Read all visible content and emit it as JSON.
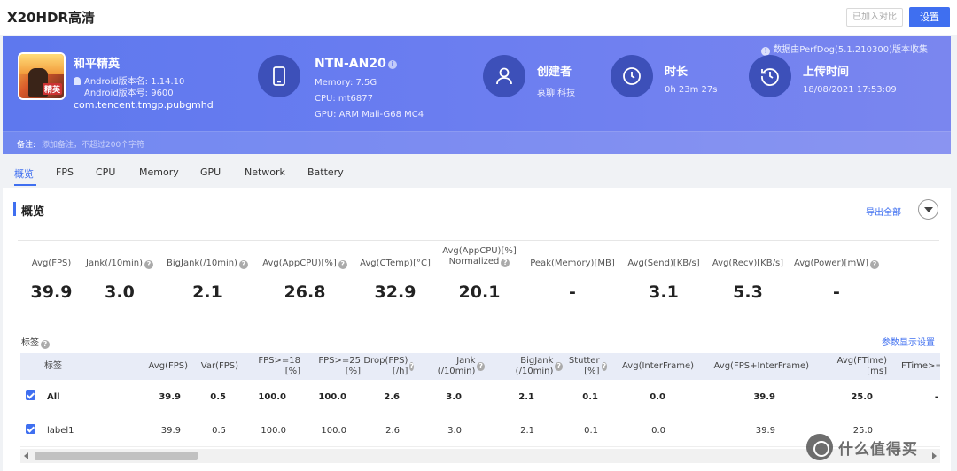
{
  "topbar": {
    "title": "X20HDR高清",
    "added_button": "已加入对比",
    "settings_button": "设置"
  },
  "banner": {
    "notice": "数据由PerfDog(5.1.210300)版本收集",
    "app": {
      "name": "和平精英",
      "icon_text": "和平精英",
      "android_version": "Android版本名: 1.14.10",
      "android_build": "Android版本号: 9600",
      "package": "com.tencent.tmgp.pubgmhd"
    },
    "device": {
      "name": "NTN-AN20",
      "memory": "Memory: 7.5G",
      "cpu": "CPU: mt6877",
      "gpu": "GPU: ARM Mali-G68 MC4"
    },
    "creator": {
      "title": "创建者",
      "value": "哀聊 科技"
    },
    "duration": {
      "title": "时长",
      "value": "0h 23m 27s"
    },
    "upload": {
      "title": "上传时间",
      "value": "18/08/2021 17:53:09"
    },
    "note_label": "备注:",
    "note_placeholder": "添加备注，不超过200个字符"
  },
  "tabs": [
    "概览",
    "FPS",
    "CPU",
    "Memory",
    "GPU",
    "Network",
    "Battery"
  ],
  "overview": {
    "title": "概览",
    "export": "导出全部",
    "metrics": [
      {
        "label": "Avg(FPS)",
        "value": "39.9",
        "help": false
      },
      {
        "label": "Jank(/10min)",
        "value": "3.0",
        "help": true
      },
      {
        "label": "BigJank(/10min)",
        "value": "2.1",
        "help": true
      },
      {
        "label": "Avg(AppCPU)[%]",
        "value": "26.8",
        "help": true
      },
      {
        "label": "Avg(CTemp)[°C]",
        "value": "32.9",
        "help": false
      },
      {
        "label": "Avg(AppCPU)[%] Normalized",
        "value": "20.1",
        "help": true
      },
      {
        "label": "Peak(Memory)[MB]",
        "value": "-",
        "help": false
      },
      {
        "label": "Avg(Send)[KB/s]",
        "value": "3.1",
        "help": false
      },
      {
        "label": "Avg(Recv)[KB/s]",
        "value": "5.3",
        "help": false
      },
      {
        "label": "Avg(Power)[mW]",
        "value": "-",
        "help": true
      }
    ],
    "tags_title": "标签",
    "param_settings": "参数显示设置",
    "table": {
      "headers": [
        "标签",
        "Avg(FPS)",
        "Var(FPS)",
        "FPS>=18 [%]",
        "FPS>=25 [%]",
        "Drop(FPS) [/h]",
        "Jank (/10min)",
        "BigJank (/10min)",
        "Stutter [%]",
        "Avg(InterFrame)",
        "Avg(FPS+InterFrame)",
        "Avg(FTime) [ms]",
        "FTime>="
      ],
      "rows": [
        {
          "label": "All",
          "checked": true,
          "cells": [
            "39.9",
            "0.5",
            "100.0",
            "100.0",
            "2.6",
            "3.0",
            "2.1",
            "0.1",
            "0.0",
            "39.9",
            "25.0",
            "-"
          ]
        },
        {
          "label": "label1",
          "checked": true,
          "cells": [
            "39.9",
            "0.5",
            "100.0",
            "100.0",
            "2.6",
            "3.0",
            "2.1",
            "0.1",
            "0.0",
            "39.9",
            "25.0",
            ""
          ]
        }
      ]
    }
  },
  "watermark": "什么值得买",
  "colors": {
    "accent": "#3f6ff0",
    "banner_start": "#5e78ee",
    "banner_end": "#7a86ef",
    "icon_circle": "#3d50b9"
  }
}
